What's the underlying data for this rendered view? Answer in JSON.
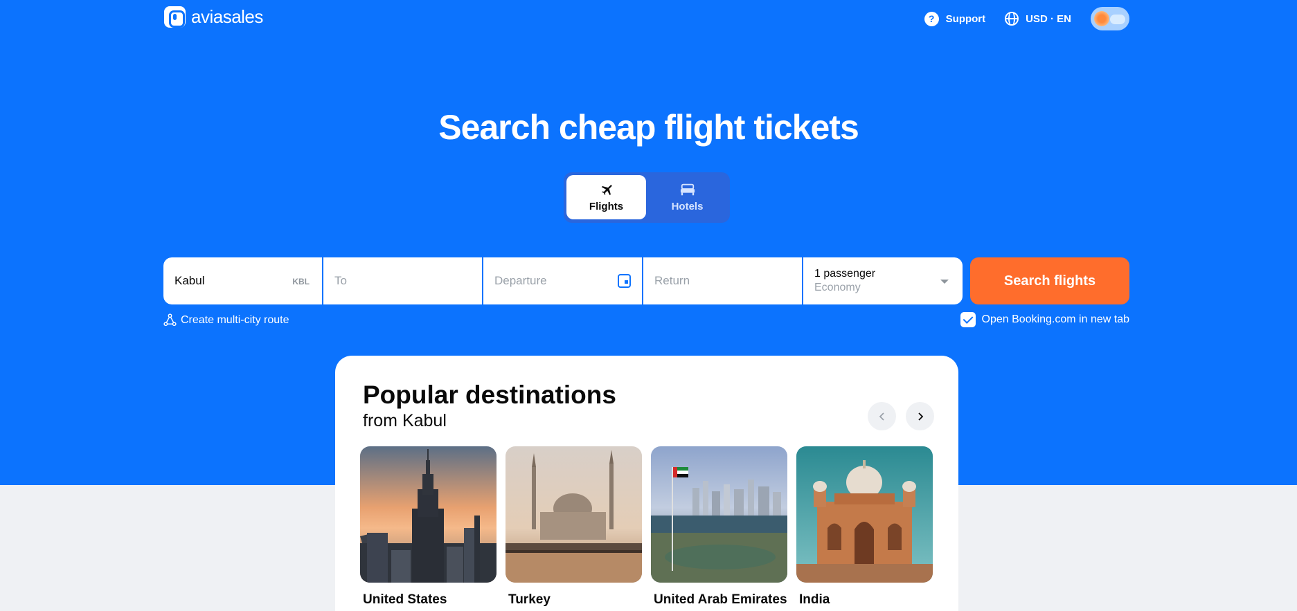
{
  "header": {
    "logo_text": "aviasales",
    "support_label": "Support",
    "locale_label": "USD · EN"
  },
  "hero": {
    "title": "Search cheap flight tickets"
  },
  "modes": {
    "flights_label": "Flights",
    "hotels_label": "Hotels",
    "active": "Flights"
  },
  "search": {
    "from_value": "Kabul",
    "from_code": "KBL",
    "to_placeholder": "To",
    "departure_placeholder": "Departure",
    "return_placeholder": "Return",
    "passengers": "1 passenger",
    "cabin_class": "Economy",
    "submit_label": "Search flights"
  },
  "options": {
    "multi_city_label": "Create multi-city route",
    "booking_label": "Open Booking.com in new tab",
    "booking_checked": true
  },
  "popular": {
    "title": "Popular destinations",
    "subtitle": "from Kabul",
    "destinations": [
      {
        "name": "United States"
      },
      {
        "name": "Turkey"
      },
      {
        "name": "United Arab Emirates"
      },
      {
        "name": "India"
      }
    ]
  },
  "colors": {
    "brand_blue": "#0c73fe",
    "cta_orange": "#ff6d2c",
    "page_background": "#eff1f4"
  }
}
